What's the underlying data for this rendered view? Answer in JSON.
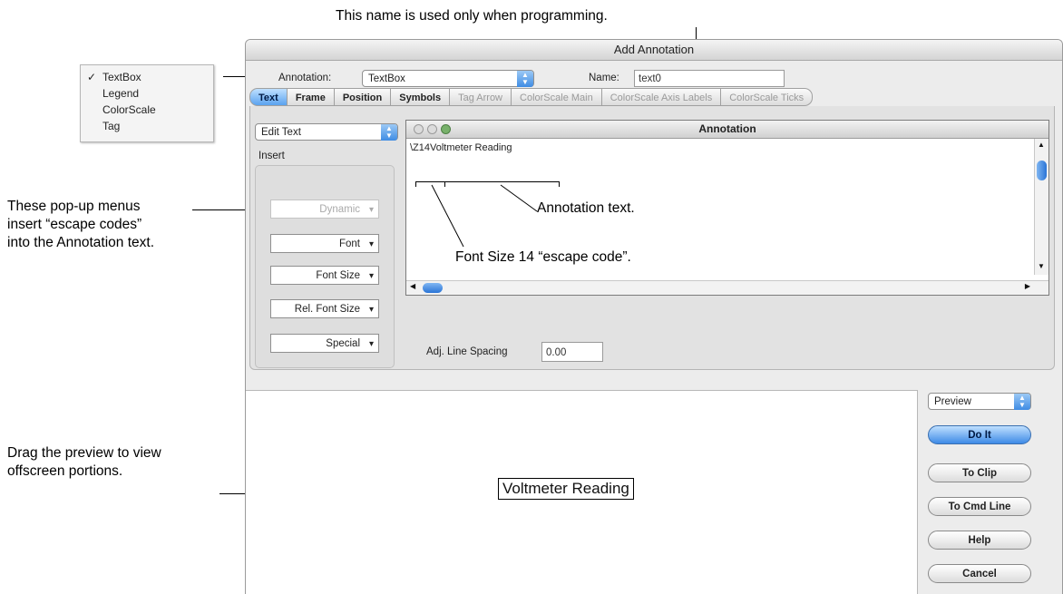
{
  "callouts": {
    "name_note": "This name is used only when programming.",
    "popup_note": [
      "These pop-up menus",
      "insert “escape codes”",
      "into the Annotation text."
    ],
    "annotation_text_note": "Annotation text.",
    "escape_code_note": "Font Size 14 “escape code”.",
    "drag_note": [
      "Drag the preview to view",
      "offscreen portions."
    ]
  },
  "annotation_menu": {
    "items": [
      "TextBox",
      "Legend",
      "ColorScale",
      "Tag"
    ],
    "checked_index": 0,
    "check_mark": "✓"
  },
  "dialog": {
    "title": "Add Annotation",
    "annotation_label": "Annotation:",
    "annotation_value": "TextBox",
    "name_label": "Name:",
    "name_value": "text0",
    "tabs": [
      {
        "label": "Text",
        "state": "active"
      },
      {
        "label": "Frame",
        "state": "normal"
      },
      {
        "label": "Position",
        "state": "normal"
      },
      {
        "label": "Symbols",
        "state": "normal"
      },
      {
        "label": "Tag Arrow",
        "state": "disabled"
      },
      {
        "label": "ColorScale Main",
        "state": "disabled"
      },
      {
        "label": "ColorScale Axis Labels",
        "state": "disabled"
      },
      {
        "label": "ColorScale Ticks",
        "state": "disabled"
      }
    ],
    "edit_text_popup": "Edit Text",
    "insert_label": "Insert",
    "insert_buttons": [
      {
        "label": "Dynamic",
        "disabled": true
      },
      {
        "label": "Font",
        "disabled": false
      },
      {
        "label": "Font Size",
        "disabled": false
      },
      {
        "label": "Rel. Font Size",
        "disabled": false
      },
      {
        "label": "Special",
        "disabled": false
      }
    ],
    "editor_title": "Annotation",
    "editor_text": "\\Z14Voltmeter Reading",
    "line_spacing_label": "Adj. Line Spacing",
    "line_spacing_value": "0.00",
    "preview_text": "Voltmeter Reading",
    "preview_popup": "Preview",
    "buttons": [
      "Do It",
      "To Clip",
      "To Cmd Line",
      "Help",
      "Cancel"
    ]
  }
}
